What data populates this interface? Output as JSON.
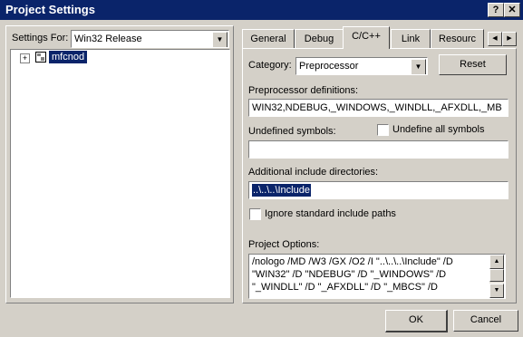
{
  "window": {
    "title": "Project Settings",
    "help_label": "?",
    "close_label": "✕"
  },
  "left": {
    "settings_for_label": "Settings For:",
    "config_value": "Win32 Release",
    "tree": {
      "expander": "+",
      "item": "mfcnod"
    }
  },
  "tabs": [
    {
      "label": "General"
    },
    {
      "label": "Debug"
    },
    {
      "label": "C/C++"
    },
    {
      "label": "Link"
    },
    {
      "label": "Resourc"
    }
  ],
  "active_tab": "C/C++",
  "cpp": {
    "category_label": "Category:",
    "category_value": "Preprocessor",
    "reset_label": "Reset",
    "preproc_label": "Preprocessor definitions:",
    "preproc_value": "WIN32,NDEBUG,_WINDOWS,_WINDLL,_AFXDLL,_MB",
    "undefined_label": "Undefined symbols:",
    "undefined_value": "",
    "undefine_all_label": "Undefine all symbols",
    "include_label": "Additional include directories:",
    "include_value": "..\\..\\..\\Include",
    "ignore_std_label": "Ignore standard include paths",
    "options_label": "Project Options:",
    "options_lines": [
      "/nologo /MD /W3 /GX /O2 /I \"..\\..\\..\\Include\" /D",
      "\"WIN32\" /D \"NDEBUG\" /D \"_WINDOWS\" /D",
      "\"_WINDLL\" /D \"_AFXDLL\" /D \"_MBCS\" /D"
    ]
  },
  "footer": {
    "ok_label": "OK",
    "cancel_label": "Cancel"
  }
}
